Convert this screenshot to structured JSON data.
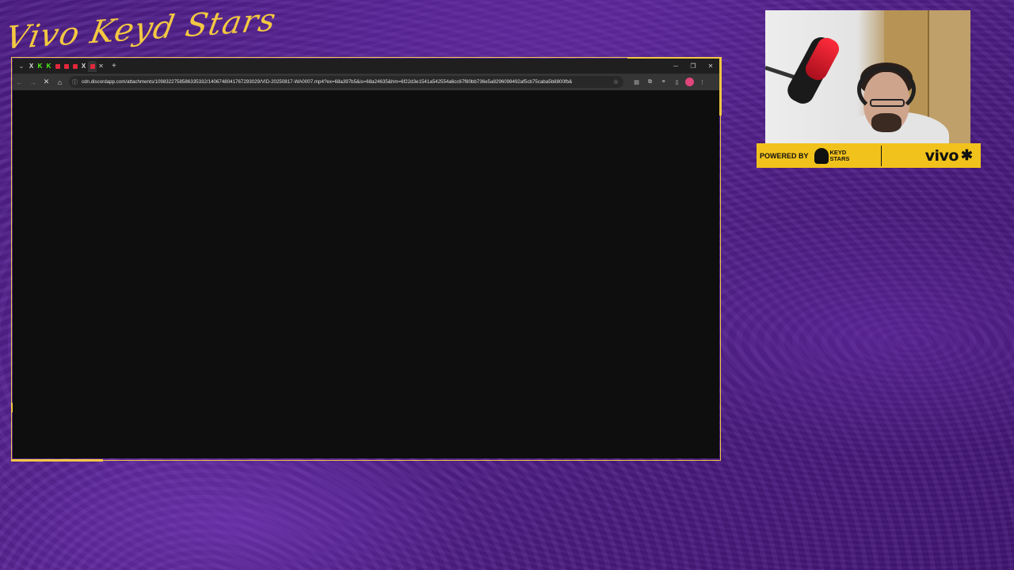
{
  "overlay": {
    "logo_text": "Vivo Keyd Stars",
    "sponsor": {
      "powered_by": "POWERED BY",
      "keyd_logo": "KEYD STARS",
      "vivo_logo": "vivo"
    },
    "colors": {
      "accent": "#f2c744",
      "banner": "#f2c21c",
      "background": "#4d1d86"
    }
  },
  "browser": {
    "tabs": [
      {
        "icon": "x-icon",
        "glyph": "𝕏"
      },
      {
        "icon": "kick-icon",
        "glyph": "K",
        "color": "#53fc18"
      },
      {
        "icon": "kick-icon",
        "glyph": "K",
        "color": "#53fc18"
      },
      {
        "icon": "red-tab-icon",
        "color": "#e2283c"
      },
      {
        "icon": "red-tab-icon",
        "color": "#e2283c"
      },
      {
        "icon": "red-tab-icon",
        "color": "#e2283c"
      },
      {
        "icon": "x-icon",
        "glyph": "𝕏"
      },
      {
        "icon": "red-tab-icon",
        "color": "#e2283c",
        "active": true
      }
    ],
    "new_tab": "+",
    "url": "cdn.discordapp.com/attachments/1098322758586335332/1406748041767293029/VID-20250817-WA0007.mp4?ex=68a397b5&is=68a24635&hm=6f22d3e1541a542554a6cc67f80bb736e5a8296098492af5cb75caba5b8800fb&"
  }
}
